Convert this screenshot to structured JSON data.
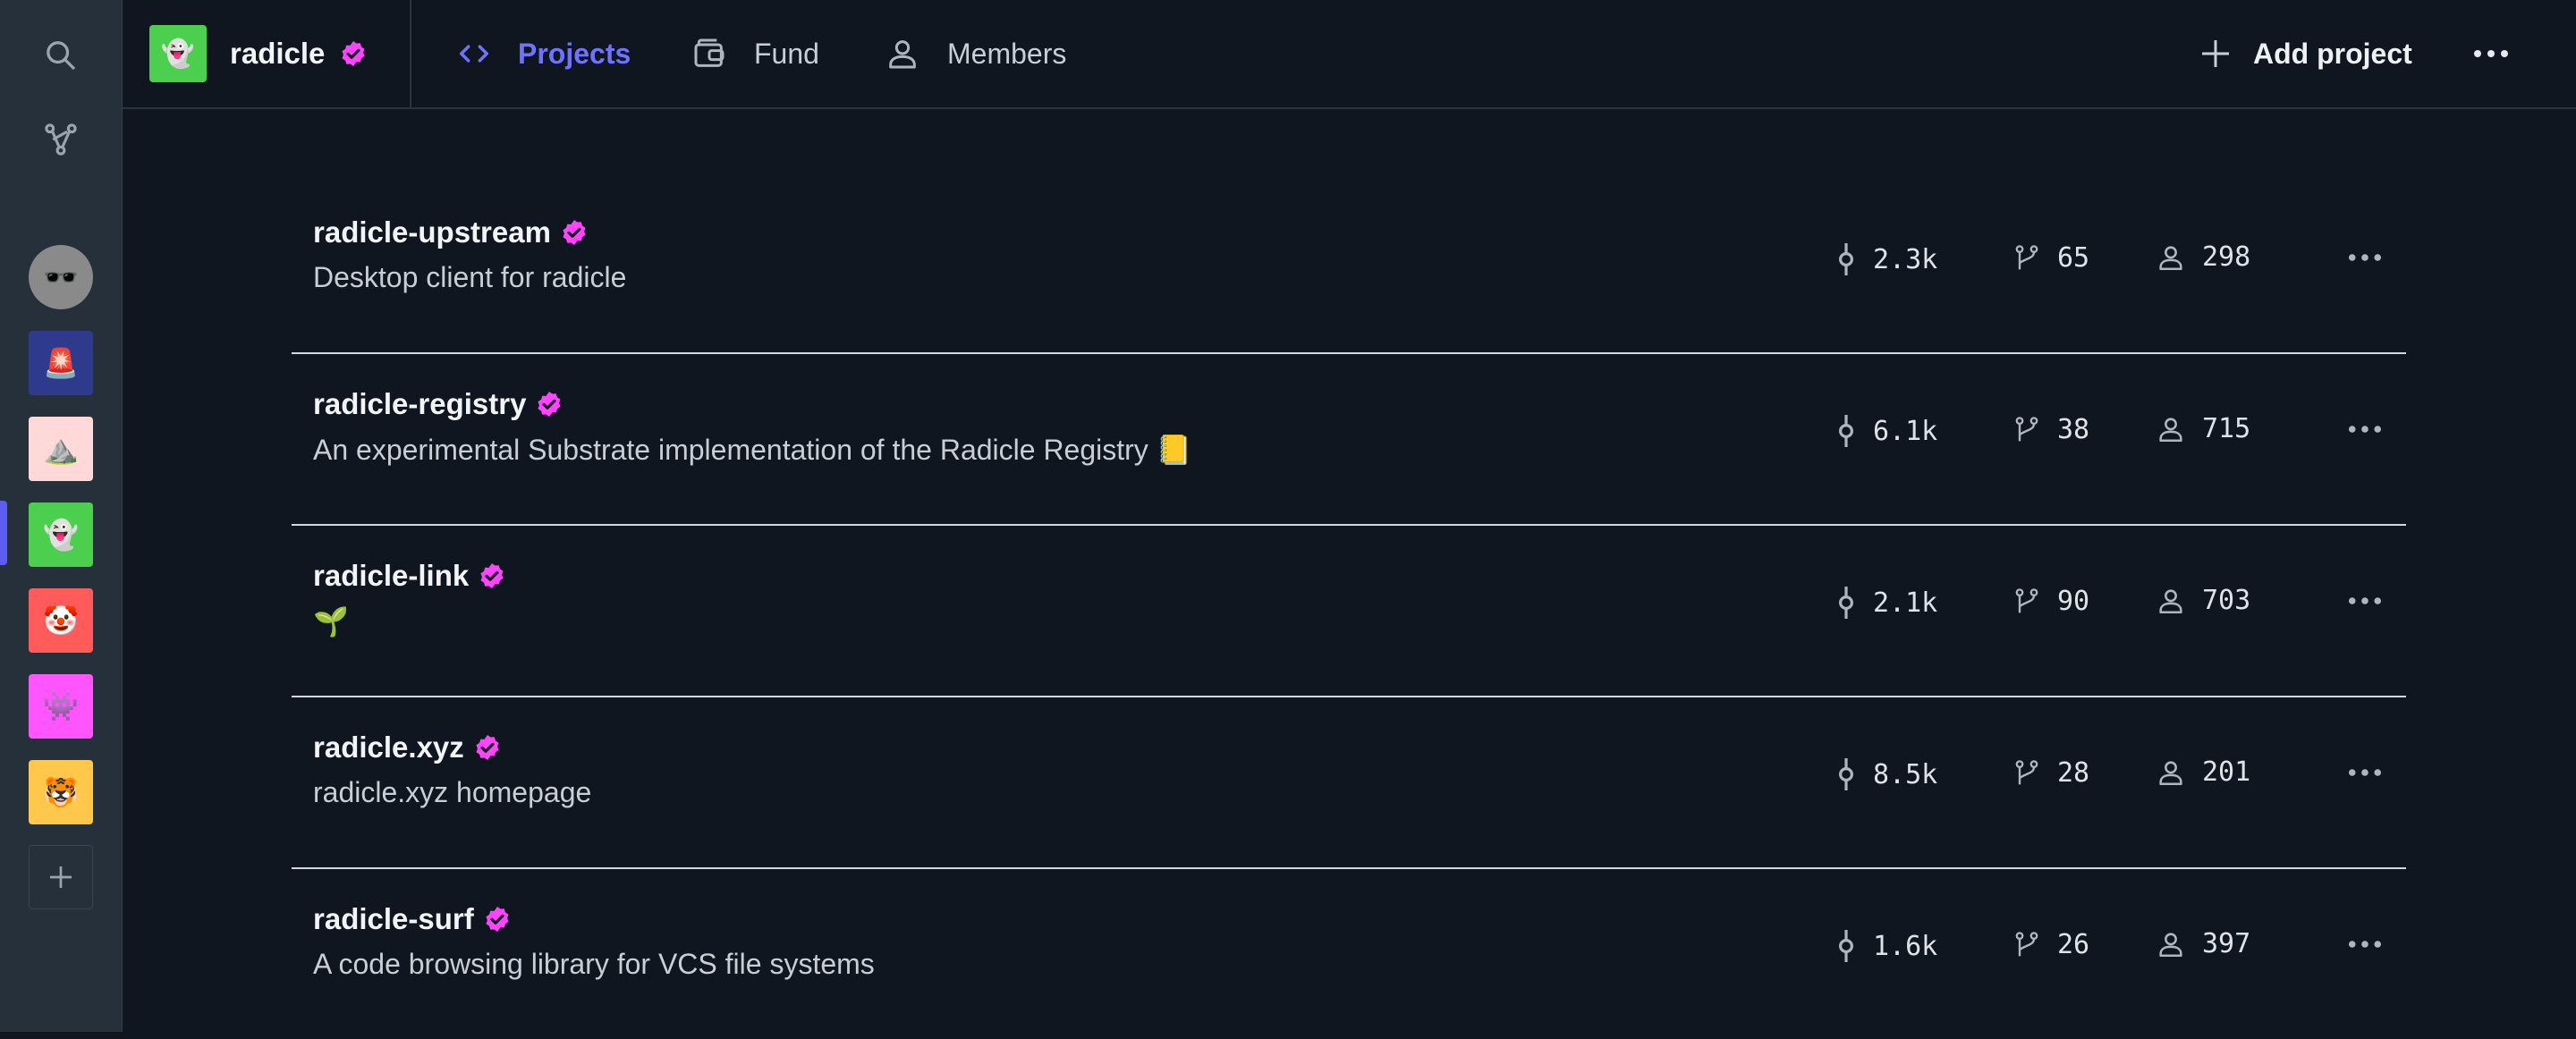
{
  "sidebar": {
    "avatars": [
      {
        "emoji": "🕶️",
        "color": "#9c9c9c"
      },
      {
        "emoji": "🚨",
        "color": "#2e3a8c"
      },
      {
        "emoji": "⛰️",
        "color": "#ffd8d8"
      },
      {
        "emoji": "👻",
        "color": "#4ccf4f"
      },
      {
        "emoji": "🤡",
        "color": "#ff5b5b"
      },
      {
        "emoji": "👾",
        "color": "#ff55ff"
      },
      {
        "emoji": "🐯",
        "color": "#ffc84a"
      }
    ],
    "active_index": 3
  },
  "header": {
    "org_name": "radicle",
    "org_avatar_emoji": "👻",
    "tabs": [
      {
        "label": "Projects",
        "icon": "code-icon",
        "active": true
      },
      {
        "label": "Fund",
        "icon": "wallet-icon",
        "active": false
      },
      {
        "label": "Members",
        "icon": "user-icon",
        "active": false
      }
    ],
    "add_project_label": "Add project"
  },
  "projects": [
    {
      "name": "radicle-upstream",
      "description": "Desktop client for radicle",
      "commits": "2.3k",
      "branches": "65",
      "contributors": "298"
    },
    {
      "name": "radicle-registry",
      "description": "An experimental Substrate implementation of the Radicle Registry 📒",
      "commits": "6.1k",
      "branches": "38",
      "contributors": "715"
    },
    {
      "name": "radicle-link",
      "description": "🌱",
      "commits": "2.1k",
      "branches": "90",
      "contributors": "703"
    },
    {
      "name": "radicle.xyz",
      "description": "radicle.xyz homepage",
      "commits": "8.5k",
      "branches": "28",
      "contributors": "201"
    },
    {
      "name": "radicle-surf",
      "description": "A code browsing library for VCS file systems",
      "commits": "1.6k",
      "branches": "26",
      "contributors": "397"
    }
  ],
  "colors": {
    "accent": "#6f73ff",
    "verified": "#ff44ff",
    "background": "#0f1620",
    "sidebar": "#26303a"
  }
}
